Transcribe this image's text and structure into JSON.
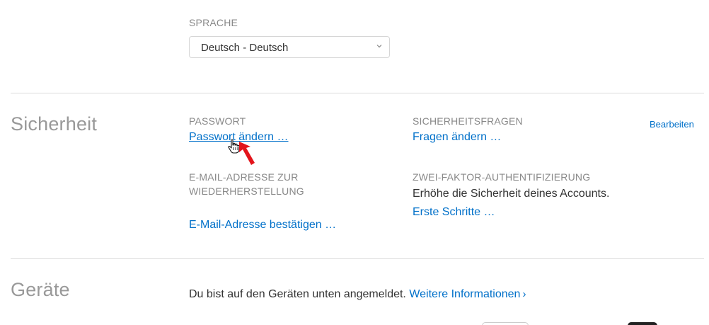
{
  "language": {
    "label": "SPRACHE",
    "selected": "Deutsch - Deutsch"
  },
  "security": {
    "title": "Sicherheit",
    "edit_label": "Bearbeiten",
    "password": {
      "label": "PASSWORT",
      "link": "Passwort ändern …"
    },
    "security_questions": {
      "label": "SICHERHEITSFRAGEN",
      "link": "Fragen ändern …"
    },
    "recovery_email": {
      "label_line1": "E-MAIL-ADRESSE ZUR",
      "label_line2": "WIEDERHERSTELLUNG",
      "link": "E-Mail-Adresse bestätigen …"
    },
    "two_factor": {
      "label": "ZWEI-FAKTOR-AUTHENTIFIZIERUNG",
      "description": "Erhöhe die Sicherheit deines Accounts.",
      "link": "Erste Schritte …"
    }
  },
  "devices": {
    "title": "Geräte",
    "description": "Du bist auf den Geräten unten angemeldet.",
    "more_info_link": "Weitere Informationen",
    "more_info_chevron": "›"
  },
  "icons": {
    "select_chevron": "chevron-down-icon",
    "cursor": "hand-pointer-icon",
    "arrow": "red-arrow-pointer-icon"
  },
  "colors": {
    "link": "#0070c9",
    "label": "#888888",
    "section_title": "#999999",
    "divider": "#dcdcdc",
    "annotation_arrow": "#e3141b"
  }
}
